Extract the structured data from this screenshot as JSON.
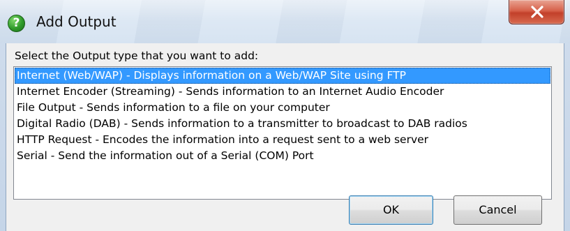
{
  "window": {
    "title": "Add Output",
    "title_icon": "help-question-icon",
    "close_icon": "close-icon",
    "close_color": "#c7432c"
  },
  "dialog": {
    "prompt": "Select the Output type that you want to add:",
    "output_types": [
      {
        "label": "Internet (Web/WAP) - Displays information on a Web/WAP Site using FTP",
        "selected": true
      },
      {
        "label": "Internet Encoder (Streaming) - Sends information to an Internet Audio Encoder",
        "selected": false
      },
      {
        "label": "File Output - Sends information to a file on your computer",
        "selected": false
      },
      {
        "label": "Digital Radio (DAB) - Sends information to a transmitter to broadcast to DAB radios",
        "selected": false
      },
      {
        "label": "HTTP Request - Encodes the information into a request sent to a web server",
        "selected": false
      },
      {
        "label": "Serial - Send the information out of a Serial (COM) Port",
        "selected": false
      }
    ],
    "selection_color": "#3399ff",
    "ok_label": "OK",
    "cancel_label": "Cancel"
  }
}
